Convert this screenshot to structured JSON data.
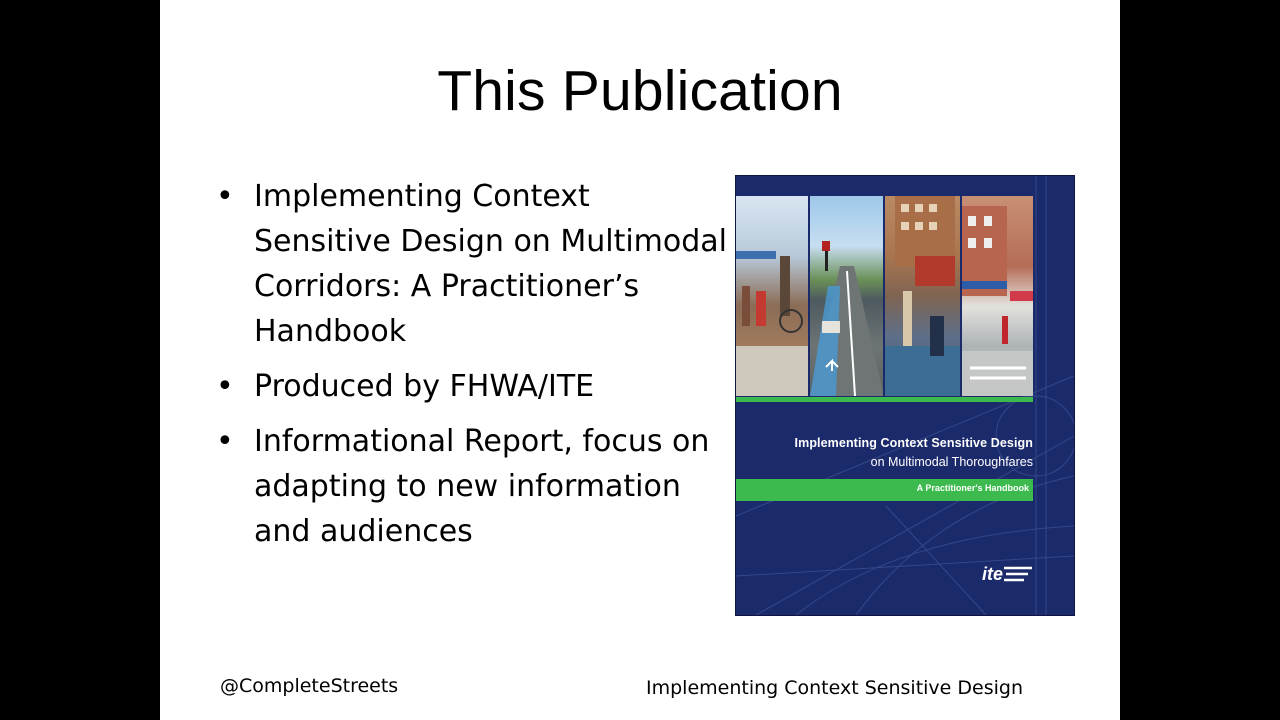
{
  "slide": {
    "title": "This Publication",
    "bullets": [
      "Implementing Context Sensitive Design on Multimodal Corridors: A Practitioner’s Handbook",
      "Produced by FHWA/ITE",
      "Informational Report, focus on adapting to new information and audiences"
    ],
    "bullet_glyph": "•",
    "footer_left": "@CompleteStreets",
    "footer_right": "Implementing Context Sensitive Design"
  },
  "cover": {
    "title": "Implementing Context Sensitive Design",
    "subtitle": "on Multimodal Thoroughfares",
    "band_text": "A Practitioner's Handbook",
    "logo_text": "ite",
    "colors": {
      "background": "#1b2a6b",
      "accent_green": "#3dba4e"
    }
  }
}
